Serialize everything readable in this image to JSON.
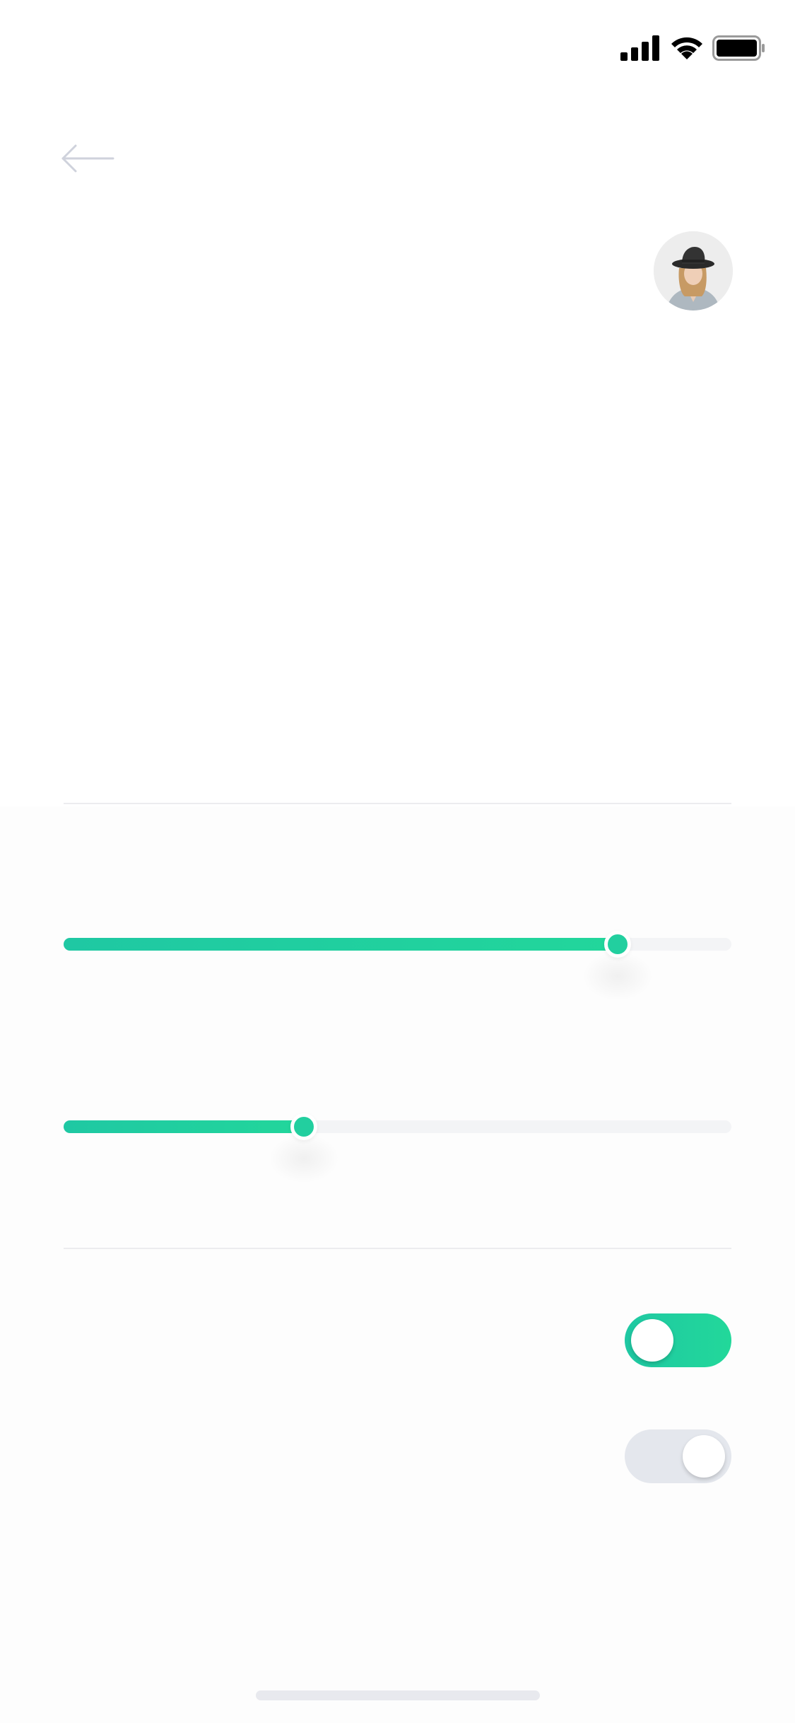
{
  "status_bar": {
    "icons": [
      "signal-icon",
      "wifi-icon",
      "battery-icon"
    ],
    "text_color": "#000000"
  },
  "header": {
    "back_icon": "arrow-left-icon",
    "back_icon_color": "#cfd2dc"
  },
  "profile": {
    "avatar": "avatar-photo"
  },
  "sliders": [
    {
      "name": "slider-1",
      "value": 0.83,
      "fill_color": "#1fcfa0",
      "track_color": "#f3f4f6"
    },
    {
      "name": "slider-2",
      "value": 0.36,
      "fill_color": "#1fcfa0",
      "track_color": "#f3f4f6"
    }
  ],
  "toggles": [
    {
      "name": "toggle-1",
      "on": true,
      "on_color": "#22d69b"
    },
    {
      "name": "toggle-2",
      "on": true,
      "off_color": "#e4e7ed"
    }
  ],
  "accent_color": "#22d69b"
}
